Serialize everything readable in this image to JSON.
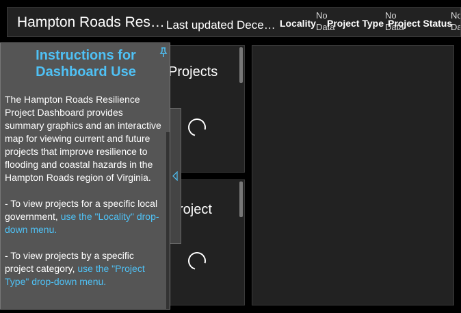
{
  "header": {
    "title": "Hampton Roads Res…",
    "updated": "Last updated Dece…",
    "filters": [
      {
        "label": "Locality",
        "value": "No Data"
      },
      {
        "label": "Project Type",
        "value": "No Data"
      },
      {
        "label": "Project Status",
        "value": "No Data"
      }
    ]
  },
  "panels": {
    "top": {
      "title": "Projects"
    },
    "bottom": {
      "title": "roject"
    }
  },
  "instructions": {
    "title": "Instructions for Dashboard Use",
    "paragraph1": "The Hampton Roads Resilience Project Dashboard provides summary graphics and an interactive map for viewing current and future projects that improve resilience to flooding and coastal hazards in the Hampton Roads region of Virginia.",
    "item1_text": "- To view projects for a specific local government, ",
    "item1_link": "use the \"Locality\" drop-down menu.",
    "item2_text": "- To view projects by a specific project category, ",
    "item2_link": "use the \"Project Type\" drop-down menu."
  },
  "colors": {
    "accent": "#4fc1f5",
    "panel_bg": "#222222",
    "sidebar_bg": "#555555"
  },
  "icons": {
    "pin": "pin-icon",
    "collapse": "collapse-arrow-icon",
    "loading": "loading-spinner-icon"
  }
}
